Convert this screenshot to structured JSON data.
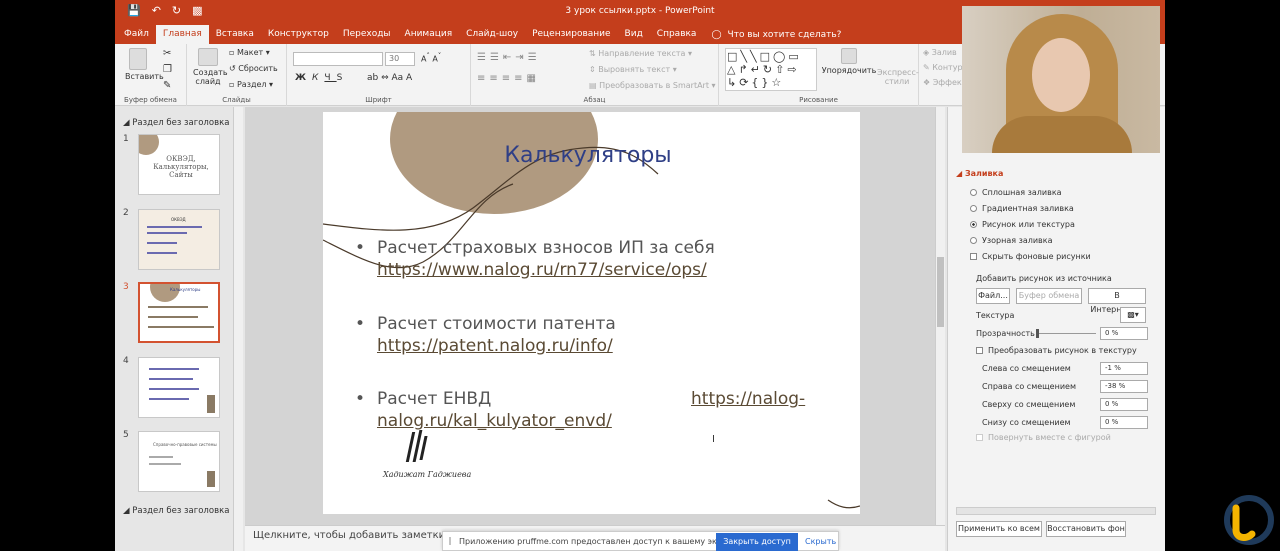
{
  "titlebar": {
    "doc_title": "3 урок ссылки.pptx  -  PowerPoint"
  },
  "tabs": [
    "Файл",
    "Главная",
    "Вставка",
    "Конструктор",
    "Переходы",
    "Анимация",
    "Слайд-шоу",
    "Рецензирование",
    "Вид",
    "Справка"
  ],
  "tell_me": "Что вы хотите сделать?",
  "ribbon": {
    "paste": "Вставить",
    "clipboard": "Буфер обмена",
    "new_slide": "Создать слайд",
    "layout": "Макет",
    "reset": "Сбросить",
    "section": "Раздел",
    "slides": "Слайды",
    "font_size": "30",
    "font": "Шрифт",
    "text_direction": "Направление текста",
    "align_text": "Выровнять текст",
    "smartart": "Преобразовать в SmartArt",
    "paragraph": "Абзац",
    "arrange": "Упорядочить",
    "quick_styles": "Экспресс-стили",
    "drawing": "Рисование",
    "fill": "Залив",
    "outline": "Контур",
    "effects": "Эффект"
  },
  "thumbnails": {
    "section_top": "Раздел без заголовка",
    "section_bottom": "Раздел без заголовка",
    "slides": [
      {
        "num": "1",
        "text": "ОКВЭД, Калькуляторы, Сайты"
      },
      {
        "num": "2",
        "text": "ОКВЭД"
      },
      {
        "num": "3",
        "text": "Калькуляторы"
      },
      {
        "num": "4",
        "text": ""
      },
      {
        "num": "5",
        "text": "Справочно-правовые системы"
      }
    ]
  },
  "slide": {
    "title": "Калькуляторы",
    "bullets": [
      {
        "line1": "Расчет страховых взносов ИП за себя",
        "link": "https://www.nalog.ru/rn77/service/ops/"
      },
      {
        "line1": "Расчет стоимости патента",
        "link": "https://patent.nalog.ru/info/"
      },
      {
        "line1": "Расчет    ЕНВД",
        "link_a": "https://nalog-",
        "link_b": "nalog.ru/kal_kulyator_envd/"
      }
    ],
    "signature": "Хадижат Гаджиева"
  },
  "notes": {
    "placeholder": "Щелкните, чтобы добавить заметки"
  },
  "share_bar": {
    "message": "Приложению pruffme.com предоставлен доступ к вашему экрану.",
    "share_button": "Закрыть доступ",
    "hide": "Скрыть"
  },
  "format_pane": {
    "fill_header": "Заливка",
    "options": [
      "Сплошная заливка",
      "Градиентная заливка",
      "Рисунок или текстура",
      "Узорная заливка"
    ],
    "selected_index": 2,
    "hide_bg": "Скрыть фоновые рисунки",
    "insert_from": "Добавить рисунок из источника",
    "file_btn": "Файл...",
    "clipboard_btn": "Буфер обмена",
    "online_btn": "В Интернете...",
    "texture": "Текстура",
    "transparency_label": "Прозрачность",
    "transparency_value": "0 %",
    "tile_label": "Преобразовать рисунок в текстуру",
    "offsets": [
      {
        "label": "Слева со смещением",
        "value": "-1 %"
      },
      {
        "label": "Справа со смещением",
        "value": "-38 %"
      },
      {
        "label": "Сверху со смещением",
        "value": "0 %"
      },
      {
        "label": "Снизу со смещением",
        "value": "0 %"
      }
    ],
    "rotate": "Повернуть вместе с фигурой",
    "apply_all": "Применить ко всем",
    "reset_bg": "Восстановить фон"
  },
  "colors": {
    "accent": "#c43e1c",
    "title": "#2f3f86",
    "link": "#5a4a34",
    "share": "#2a6ad0"
  }
}
